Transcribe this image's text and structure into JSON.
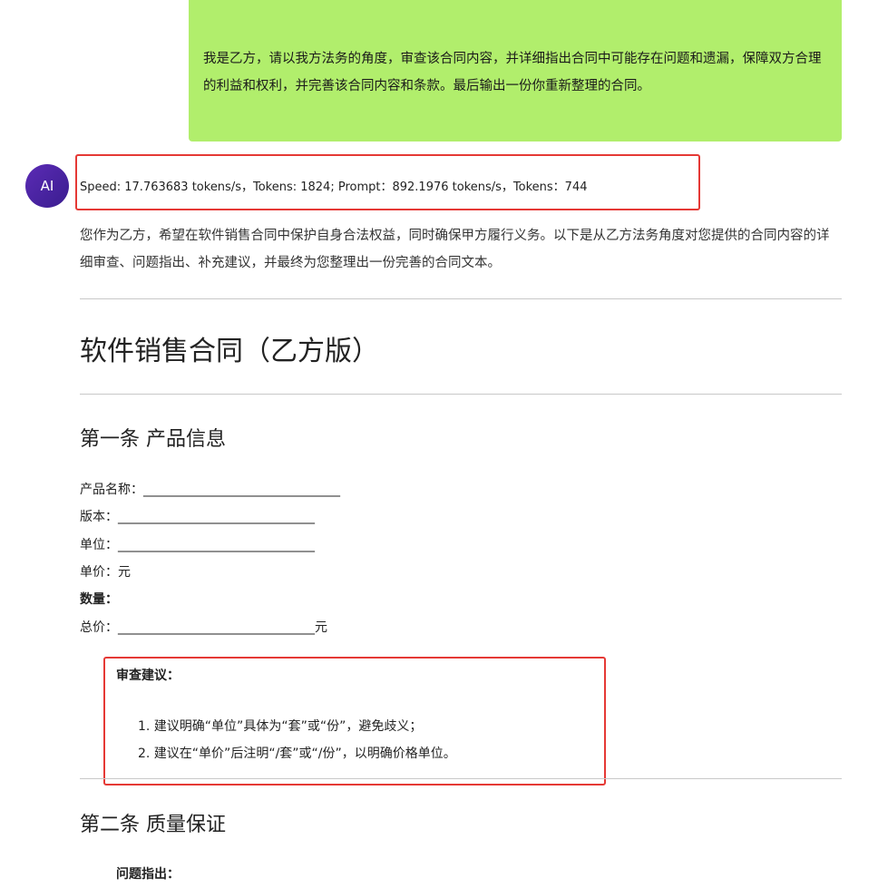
{
  "user_message": {
    "text": "我是乙方，请以我方法务的角度，审查该合同内容，并详细指出合同中可能存在问题和遗漏，保障双方合理的利益和权利，并完善该合同内容和条款。最后输出一份你重新整理的合同。",
    "bubble_color": "#b1ee6c"
  },
  "assistant": {
    "avatar_label": "AI",
    "speed": "Speed: 17.763683 tokens/s，Tokens: 1824; Prompt：892.1976 tokens/s，Tokens：744",
    "intro": "您作为乙方，希望在软件销售合同中保护自身合法权益，同时确保甲方履行义务。以下是从乙方法务角度对您提供的合同内容的详细审查、问题指出、补充建议，并最终为您整理出一份完善的合同文本。",
    "contract_title": "软件销售合同（乙方版）",
    "section1": {
      "heading": "第一条 产品信息",
      "lines": [
        "产品名称：_______________________________",
        "版本：_______________________________",
        "单位：_______________________________",
        "单价：元",
        "数量：",
        "总价：_______________________________元"
      ],
      "review_title": "审查建议：",
      "review_items": [
        "1. 建议明确“单位”具体为“套”或“份”，避免歧义；",
        "2. 建议在“单价”后注明“/套”或“/份”，以明确价格单位。"
      ]
    },
    "section2": {
      "heading": "第二条 质量保证",
      "issue_title": "问题指出："
    }
  },
  "highlight_color": "#e53935"
}
